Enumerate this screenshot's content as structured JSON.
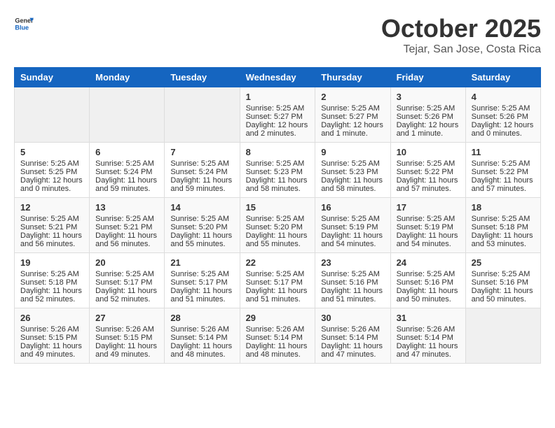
{
  "header": {
    "logo_line1": "General",
    "logo_line2": "Blue",
    "month": "October 2025",
    "location": "Tejar, San Jose, Costa Rica"
  },
  "weekdays": [
    "Sunday",
    "Monday",
    "Tuesday",
    "Wednesday",
    "Thursday",
    "Friday",
    "Saturday"
  ],
  "weeks": [
    [
      {
        "day": "",
        "sunrise": "",
        "sunset": "",
        "daylight": "",
        "empty": true
      },
      {
        "day": "",
        "sunrise": "",
        "sunset": "",
        "daylight": "",
        "empty": true
      },
      {
        "day": "",
        "sunrise": "",
        "sunset": "",
        "daylight": "",
        "empty": true
      },
      {
        "day": "1",
        "sunrise": "Sunrise: 5:25 AM",
        "sunset": "Sunset: 5:27 PM",
        "daylight": "Daylight: 12 hours and 2 minutes."
      },
      {
        "day": "2",
        "sunrise": "Sunrise: 5:25 AM",
        "sunset": "Sunset: 5:27 PM",
        "daylight": "Daylight: 12 hours and 1 minute."
      },
      {
        "day": "3",
        "sunrise": "Sunrise: 5:25 AM",
        "sunset": "Sunset: 5:26 PM",
        "daylight": "Daylight: 12 hours and 1 minute."
      },
      {
        "day": "4",
        "sunrise": "Sunrise: 5:25 AM",
        "sunset": "Sunset: 5:26 PM",
        "daylight": "Daylight: 12 hours and 0 minutes."
      }
    ],
    [
      {
        "day": "5",
        "sunrise": "Sunrise: 5:25 AM",
        "sunset": "Sunset: 5:25 PM",
        "daylight": "Daylight: 12 hours and 0 minutes."
      },
      {
        "day": "6",
        "sunrise": "Sunrise: 5:25 AM",
        "sunset": "Sunset: 5:24 PM",
        "daylight": "Daylight: 11 hours and 59 minutes."
      },
      {
        "day": "7",
        "sunrise": "Sunrise: 5:25 AM",
        "sunset": "Sunset: 5:24 PM",
        "daylight": "Daylight: 11 hours and 59 minutes."
      },
      {
        "day": "8",
        "sunrise": "Sunrise: 5:25 AM",
        "sunset": "Sunset: 5:23 PM",
        "daylight": "Daylight: 11 hours and 58 minutes."
      },
      {
        "day": "9",
        "sunrise": "Sunrise: 5:25 AM",
        "sunset": "Sunset: 5:23 PM",
        "daylight": "Daylight: 11 hours and 58 minutes."
      },
      {
        "day": "10",
        "sunrise": "Sunrise: 5:25 AM",
        "sunset": "Sunset: 5:22 PM",
        "daylight": "Daylight: 11 hours and 57 minutes."
      },
      {
        "day": "11",
        "sunrise": "Sunrise: 5:25 AM",
        "sunset": "Sunset: 5:22 PM",
        "daylight": "Daylight: 11 hours and 57 minutes."
      }
    ],
    [
      {
        "day": "12",
        "sunrise": "Sunrise: 5:25 AM",
        "sunset": "Sunset: 5:21 PM",
        "daylight": "Daylight: 11 hours and 56 minutes."
      },
      {
        "day": "13",
        "sunrise": "Sunrise: 5:25 AM",
        "sunset": "Sunset: 5:21 PM",
        "daylight": "Daylight: 11 hours and 56 minutes."
      },
      {
        "day": "14",
        "sunrise": "Sunrise: 5:25 AM",
        "sunset": "Sunset: 5:20 PM",
        "daylight": "Daylight: 11 hours and 55 minutes."
      },
      {
        "day": "15",
        "sunrise": "Sunrise: 5:25 AM",
        "sunset": "Sunset: 5:20 PM",
        "daylight": "Daylight: 11 hours and 55 minutes."
      },
      {
        "day": "16",
        "sunrise": "Sunrise: 5:25 AM",
        "sunset": "Sunset: 5:19 PM",
        "daylight": "Daylight: 11 hours and 54 minutes."
      },
      {
        "day": "17",
        "sunrise": "Sunrise: 5:25 AM",
        "sunset": "Sunset: 5:19 PM",
        "daylight": "Daylight: 11 hours and 54 minutes."
      },
      {
        "day": "18",
        "sunrise": "Sunrise: 5:25 AM",
        "sunset": "Sunset: 5:18 PM",
        "daylight": "Daylight: 11 hours and 53 minutes."
      }
    ],
    [
      {
        "day": "19",
        "sunrise": "Sunrise: 5:25 AM",
        "sunset": "Sunset: 5:18 PM",
        "daylight": "Daylight: 11 hours and 52 minutes."
      },
      {
        "day": "20",
        "sunrise": "Sunrise: 5:25 AM",
        "sunset": "Sunset: 5:17 PM",
        "daylight": "Daylight: 11 hours and 52 minutes."
      },
      {
        "day": "21",
        "sunrise": "Sunrise: 5:25 AM",
        "sunset": "Sunset: 5:17 PM",
        "daylight": "Daylight: 11 hours and 51 minutes."
      },
      {
        "day": "22",
        "sunrise": "Sunrise: 5:25 AM",
        "sunset": "Sunset: 5:17 PM",
        "daylight": "Daylight: 11 hours and 51 minutes."
      },
      {
        "day": "23",
        "sunrise": "Sunrise: 5:25 AM",
        "sunset": "Sunset: 5:16 PM",
        "daylight": "Daylight: 11 hours and 51 minutes."
      },
      {
        "day": "24",
        "sunrise": "Sunrise: 5:25 AM",
        "sunset": "Sunset: 5:16 PM",
        "daylight": "Daylight: 11 hours and 50 minutes."
      },
      {
        "day": "25",
        "sunrise": "Sunrise: 5:25 AM",
        "sunset": "Sunset: 5:16 PM",
        "daylight": "Daylight: 11 hours and 50 minutes."
      }
    ],
    [
      {
        "day": "26",
        "sunrise": "Sunrise: 5:26 AM",
        "sunset": "Sunset: 5:15 PM",
        "daylight": "Daylight: 11 hours and 49 minutes."
      },
      {
        "day": "27",
        "sunrise": "Sunrise: 5:26 AM",
        "sunset": "Sunset: 5:15 PM",
        "daylight": "Daylight: 11 hours and 49 minutes."
      },
      {
        "day": "28",
        "sunrise": "Sunrise: 5:26 AM",
        "sunset": "Sunset: 5:14 PM",
        "daylight": "Daylight: 11 hours and 48 minutes."
      },
      {
        "day": "29",
        "sunrise": "Sunrise: 5:26 AM",
        "sunset": "Sunset: 5:14 PM",
        "daylight": "Daylight: 11 hours and 48 minutes."
      },
      {
        "day": "30",
        "sunrise": "Sunrise: 5:26 AM",
        "sunset": "Sunset: 5:14 PM",
        "daylight": "Daylight: 11 hours and 47 minutes."
      },
      {
        "day": "31",
        "sunrise": "Sunrise: 5:26 AM",
        "sunset": "Sunset: 5:14 PM",
        "daylight": "Daylight: 11 hours and 47 minutes."
      },
      {
        "day": "",
        "sunrise": "",
        "sunset": "",
        "daylight": "",
        "empty": true
      }
    ]
  ]
}
